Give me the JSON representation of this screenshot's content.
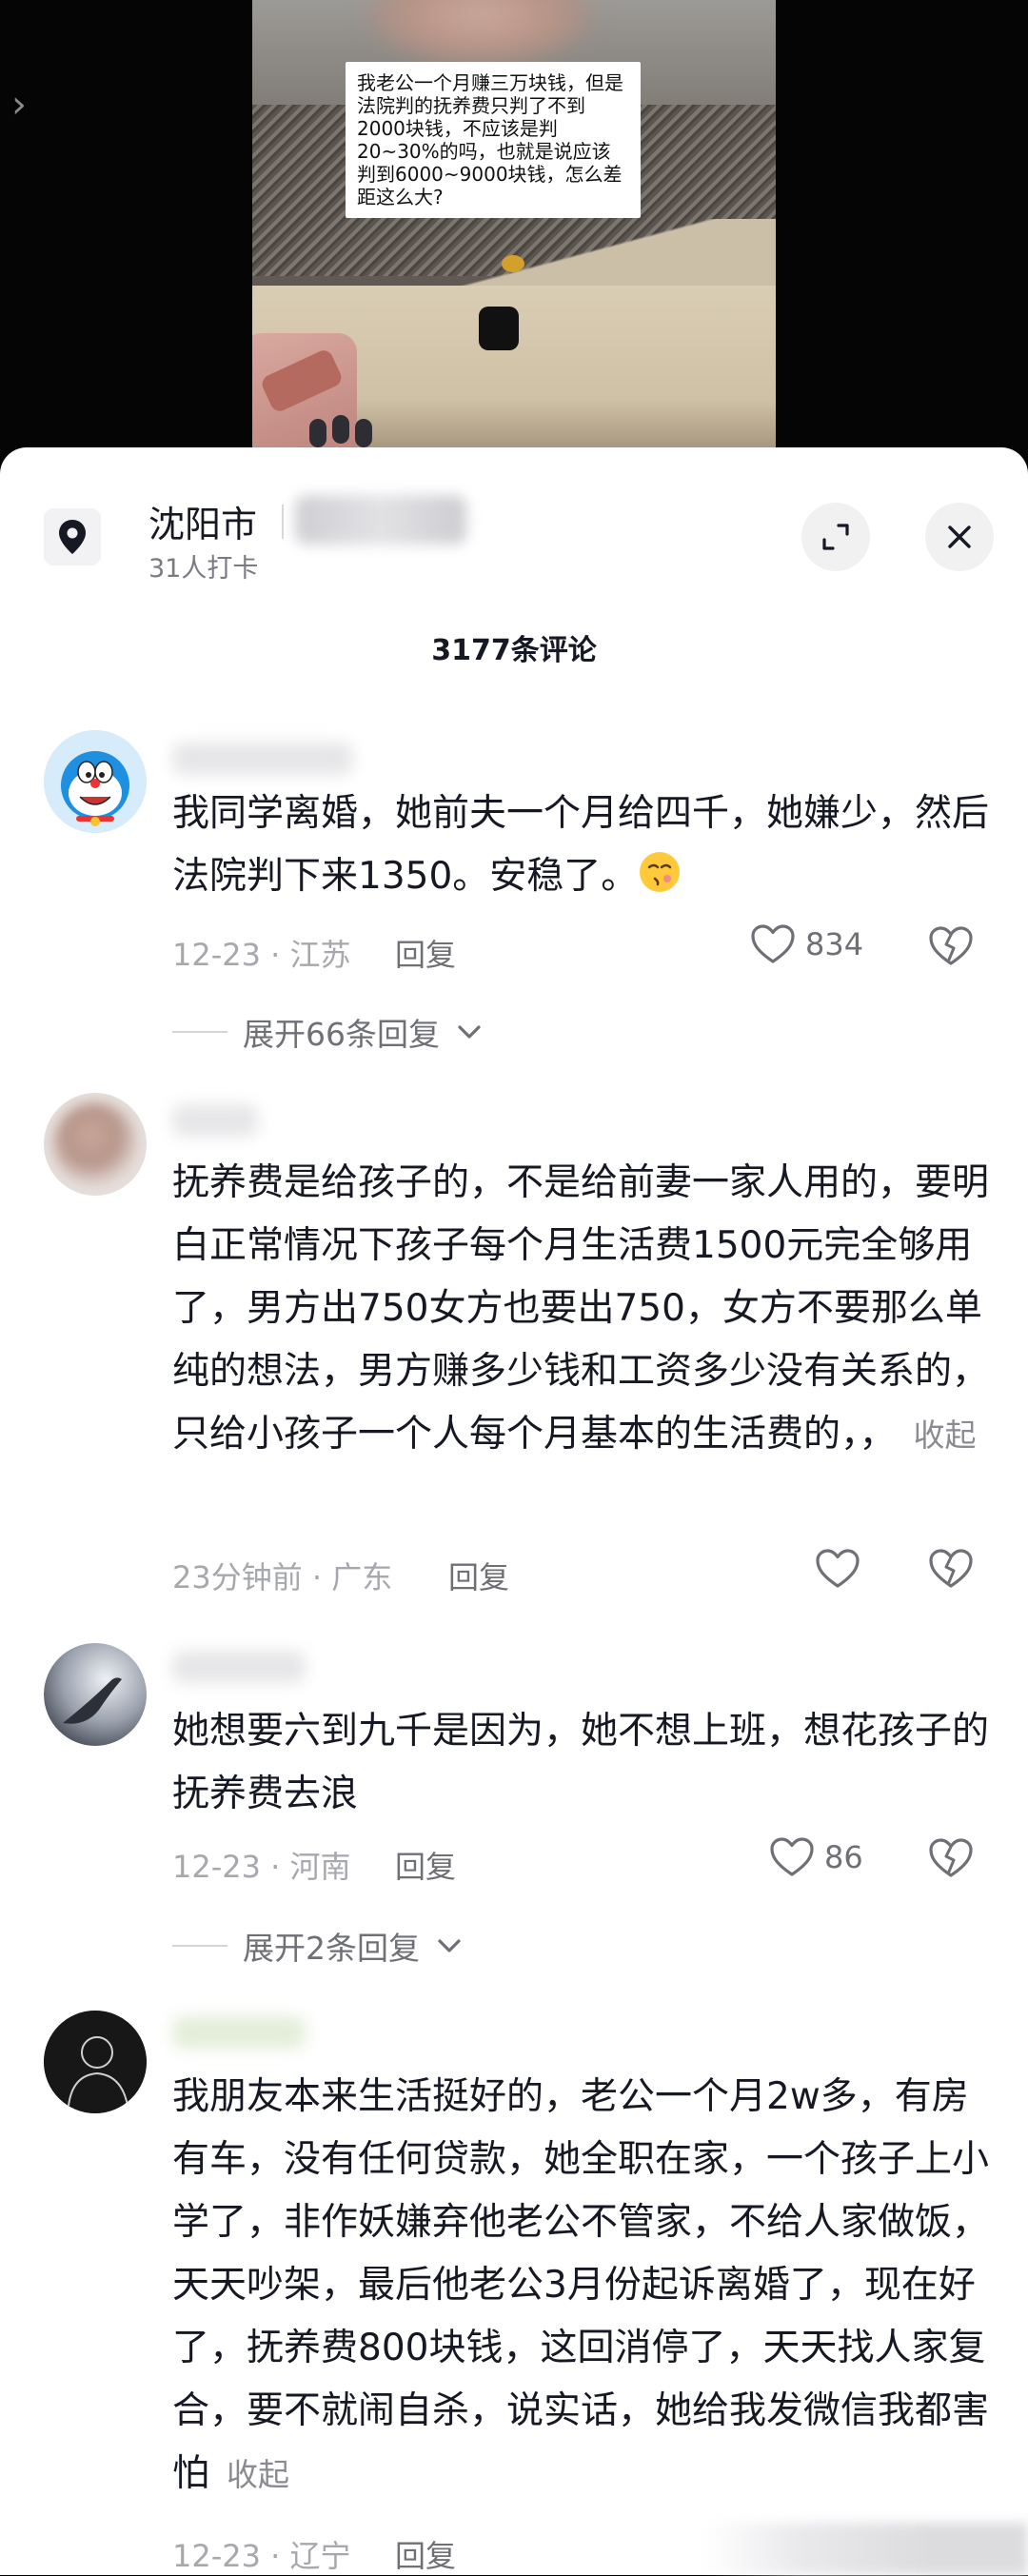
{
  "video": {
    "caption": "我老公一个月赚三万块钱，但是法院判的抚养费只判了不到2000块钱，不应该是判20~30%的吗，也就是说应该判到6000~9000块钱，怎么差距这么大?",
    "side_arrow_icon": "chevron-right-icon"
  },
  "location": {
    "city": "沈阳市",
    "checkins": "31人打卡"
  },
  "header": {
    "comment_count": "3177条评论",
    "expand_icon": "fullscreen-icon",
    "close_icon": "close-icon"
  },
  "comments": [
    {
      "text": "我同学离婚，她前夫一个月给四千，她嫌少，然后法院判下来1350。安稳了。",
      "time": "12-23",
      "region": "江苏",
      "reply_label": "回复",
      "likes": "834",
      "expand_replies": "展开66条回复"
    },
    {
      "text": "抚养费是给孩子的，不是给前妻一家人用的，要明白正常情况下孩子每个月生活费1500元完全够用了，男方出750女方也要出750，女方不要那么单纯的想法，男方赚多少钱和工资多少没有关系的，只给小孩子一个人每个月基本的生活费的，，",
      "collapse_label": "收起",
      "time": "23分钟前",
      "region": "广东",
      "reply_label": "回复"
    },
    {
      "text": "她想要六到九千是因为，她不想上班，想花孩子的抚养费去浪",
      "time": "12-23",
      "region": "河南",
      "reply_label": "回复",
      "likes": "86",
      "expand_replies": "展开2条回复"
    },
    {
      "text": "我朋友本来生活挺好的，老公一个月2w多，有房有车，没有任何贷款，她全职在家，一个孩子上小学了，非作妖嫌弃他老公不管家，不给人家做饭，天天吵架，最后他老公3月份起诉离婚了，现在好了，抚养费800块钱，这回消停了，天天找人家复合，要不就闹自杀，说实话，她给我发微信我都害怕",
      "collapse_label": "收起",
      "time": "12-23",
      "region": "辽宁",
      "reply_label": "回复"
    }
  ],
  "separator": "·",
  "colors": {
    "text": "#161823",
    "meta": "#a7a8ad",
    "secondary": "#6f7076",
    "sheet_bg": "#ffffff"
  }
}
